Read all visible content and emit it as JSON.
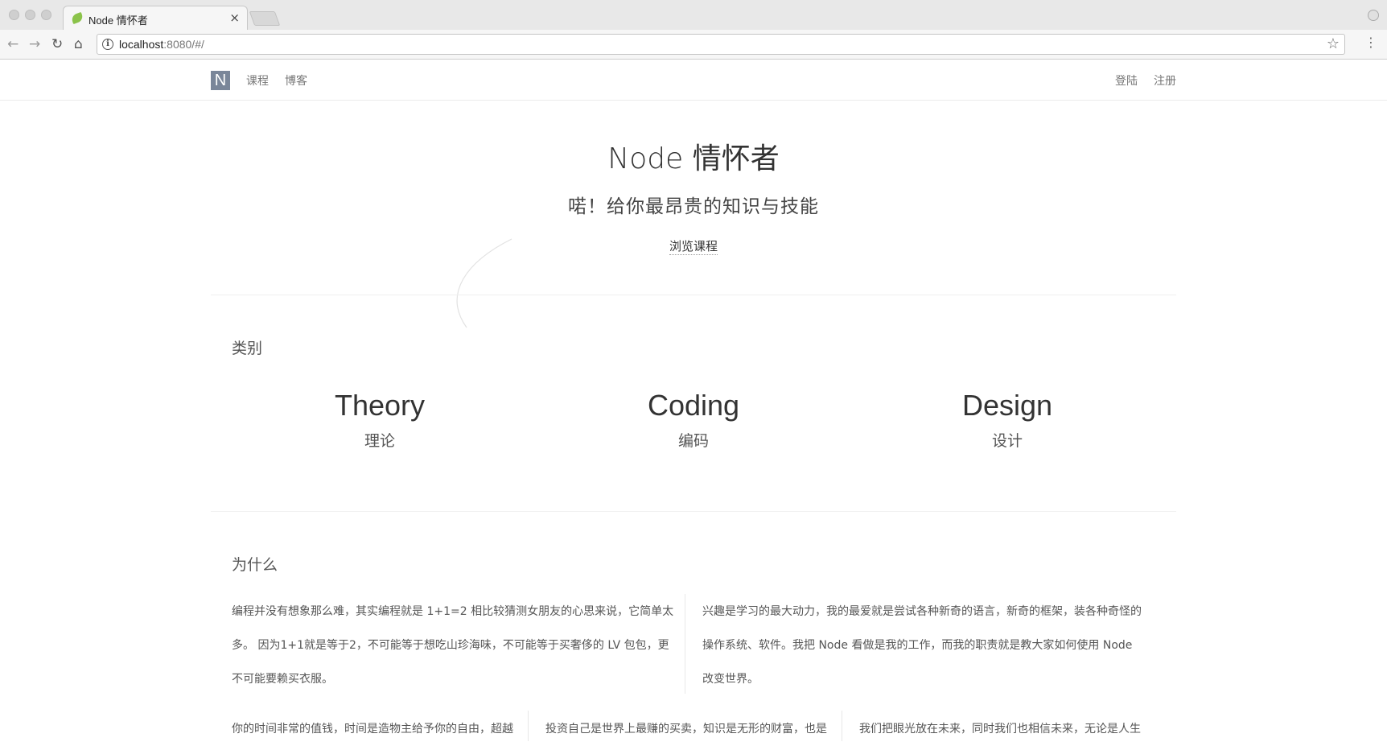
{
  "browser": {
    "tab_title": "Node 情怀者",
    "tab_close": "×",
    "url_host": "localhost",
    "url_rest": ":8080/#/",
    "back_glyph": "←",
    "forward_glyph": "→",
    "reload_glyph": "↻",
    "home_glyph": "⌂",
    "info_glyph": "i",
    "star_glyph": "☆",
    "menu_glyph": "⋮"
  },
  "nav": {
    "logo": "N",
    "links": [
      "课程",
      "博客"
    ],
    "auth": [
      "登陆",
      "注册"
    ]
  },
  "hero": {
    "title": "Node 情怀者",
    "subtitle": "喏！给你最昂贵的知识与技能",
    "cta": "浏览课程"
  },
  "categories": {
    "title": "类别",
    "items": [
      {
        "en": "Theory",
        "cn": "理论"
      },
      {
        "en": "Coding",
        "cn": "编码"
      },
      {
        "en": "Design",
        "cn": "设计"
      }
    ]
  },
  "why": {
    "title": "为什么",
    "row1": [
      [
        "编程并没有想象那么难，其实编程就是 1+1=2 相比较猜测女朋友的心思来说，它简单太",
        "多。 因为1+1就是等于2，不可能等于想吃山珍海味，不可能等于买奢侈的 LV 包包，更",
        "不可能要赖买衣服。"
      ],
      [
        "兴趣是学习的最大动力，我的最爱就是尝试各种新奇的语言，新奇的框架，装各种奇怪的",
        "操作系统、软件。我把 Node 看做是我的工作，而我的职责就是教大家如何使用 Node",
        "改变世界。"
      ]
    ],
    "row2": [
      "你的时间非常的值钱，时间是造物主给予你的自由，超越",
      "投资自己是世界上最赚的买卖，知识是无形的财富，也是",
      "我们把眼光放在未来，同时我们也相信未来，无论是人生"
    ]
  },
  "colors": {
    "logo_bg": "#7a8699",
    "text": "#333333",
    "muted": "#777777"
  }
}
